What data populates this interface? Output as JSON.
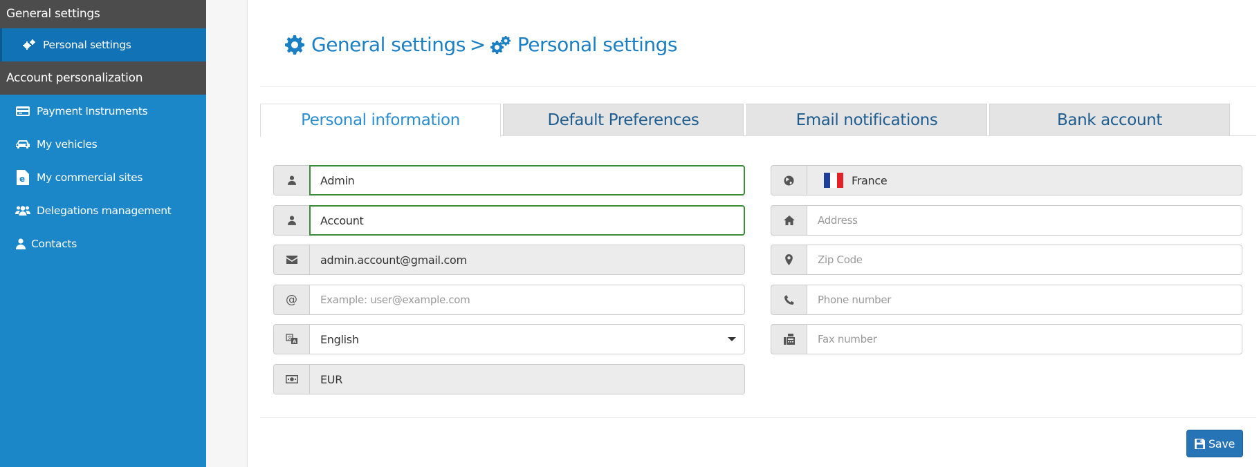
{
  "sidebar": {
    "section_general": "General settings",
    "personal_settings": "Personal settings",
    "section_account": "Account personalization",
    "items": [
      {
        "label": "Payment Instruments",
        "icon": "credit-card-icon"
      },
      {
        "label": "My vehicles",
        "icon": "car-icon"
      },
      {
        "label": "My commercial sites",
        "icon": "e-document-icon"
      },
      {
        "label": "Delegations management",
        "icon": "users-icon"
      },
      {
        "label": "Contacts",
        "icon": "user-icon"
      }
    ]
  },
  "header": {
    "crumb_general": "General settings",
    "separator": ">",
    "crumb_personal": "Personal settings"
  },
  "tabs": [
    {
      "label": "Personal information",
      "active": true
    },
    {
      "label": "Default Preferences",
      "active": false
    },
    {
      "label": "Email notifications",
      "active": false
    },
    {
      "label": "Bank account",
      "active": false
    }
  ],
  "form": {
    "first_name": {
      "value": "Admin",
      "icon": "user-icon"
    },
    "last_name": {
      "value": "Account",
      "icon": "user-icon"
    },
    "email": {
      "value": "admin.account@gmail.com",
      "icon": "envelope-icon"
    },
    "secondary_email": {
      "value": "",
      "placeholder": "Example: user@example.com",
      "icon": "at-icon"
    },
    "language": {
      "value": "English",
      "icon": "translate-icon"
    },
    "currency": {
      "value": "EUR",
      "icon": "money-icon"
    },
    "country": {
      "value": "France",
      "icon": "globe-icon"
    },
    "address": {
      "value": "",
      "placeholder": "Address",
      "icon": "home-icon"
    },
    "zip": {
      "value": "",
      "placeholder": "Zip Code",
      "icon": "map-marker-icon"
    },
    "phone": {
      "value": "",
      "placeholder": "Phone number",
      "icon": "phone-icon"
    },
    "fax": {
      "value": "",
      "placeholder": "Fax number",
      "icon": "fax-icon"
    }
  },
  "actions": {
    "save_label": "Save"
  },
  "colors": {
    "sidebar_bg": "#1b87c9",
    "section_bg": "#4c4c4c",
    "accent": "#1b7fc4",
    "valid_border": "#3c8a3c",
    "save_bg": "#2673b6"
  }
}
